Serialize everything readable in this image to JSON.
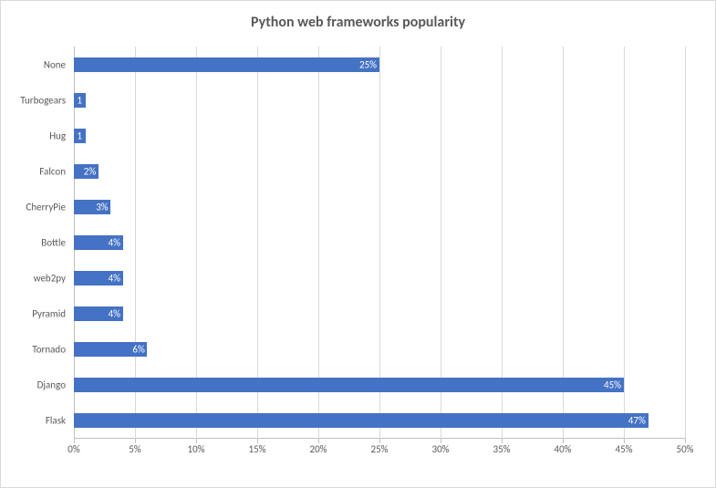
{
  "chart_data": {
    "type": "bar",
    "title": "Python web frameworks popularity",
    "categories": [
      "Flask",
      "Django",
      "Tornado",
      "Pyramid",
      "web2py",
      "Bottle",
      "CherryPie",
      "Falcon",
      "Hug",
      "Turbogears",
      "None"
    ],
    "values": [
      47,
      45,
      6,
      4,
      4,
      4,
      3,
      2,
      1,
      1,
      25
    ],
    "value_labels": [
      "47%",
      "45%",
      "6%",
      "4%",
      "4%",
      "4%",
      "3%",
      "2%",
      "1",
      "1",
      "25%"
    ],
    "xlim": [
      0,
      50
    ],
    "x_ticks": [
      0,
      5,
      10,
      15,
      20,
      25,
      30,
      35,
      40,
      45,
      50
    ],
    "x_tick_labels": [
      "0%",
      "5%",
      "10%",
      "15%",
      "20%",
      "25%",
      "30%",
      "35%",
      "40%",
      "45%",
      "50%"
    ],
    "xlabel": "",
    "ylabel": ""
  }
}
